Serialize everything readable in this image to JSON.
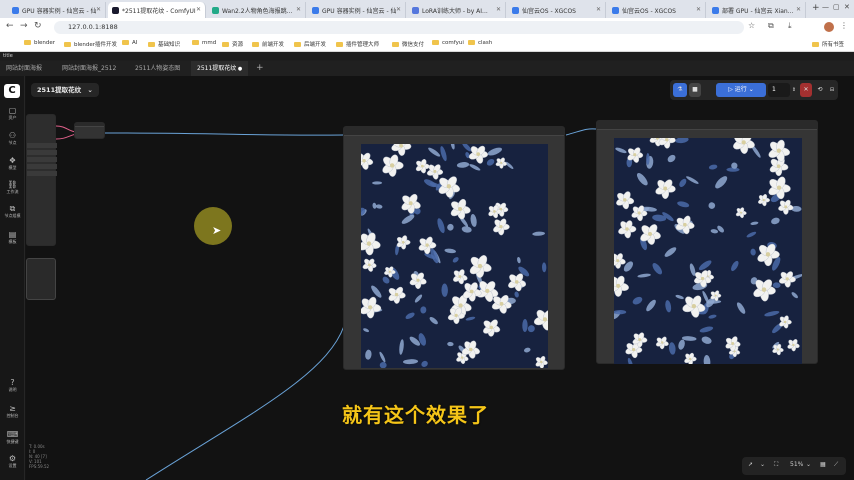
{
  "browser": {
    "tabs": [
      {
        "label": "GPU 容器实例 - 仙宫云 - 仙",
        "color": "#3b7bea",
        "active": false
      },
      {
        "label": "*2511提取花纹 - ComfyUI",
        "color": "#1a1a2e",
        "active": true
      },
      {
        "label": "Wan2.2人物角色海报跳...",
        "color": "#22aa88",
        "active": false
      },
      {
        "label": "GPU 容器实例 - 仙宫云 - 仙",
        "color": "#3b7bea",
        "active": false
      },
      {
        "label": "LoRA训练大师 - by AI...",
        "color": "#5577dd",
        "active": false
      },
      {
        "label": "仙宫云OS - XGCOS",
        "color": "#3b7bea",
        "active": false
      },
      {
        "label": "仙宫云OS - XGCOS",
        "color": "#3b7bea",
        "active": false
      },
      {
        "label": "部署 GPU - 仙宫云 Xian...",
        "color": "#3b7bea",
        "active": false
      }
    ],
    "url": "127.0.0.1:8188",
    "bookmarks": [
      "blender",
      "blender插件开发",
      "AI",
      "基础知识",
      "mmd",
      "资源",
      "前端开发",
      "后端开发",
      "插件管理大师",
      "微信支付",
      "comfyui",
      "clash"
    ],
    "all_bookmarks_label": "所有书签"
  },
  "app": {
    "title": "title",
    "workflow_tabs": [
      {
        "label": "网站封面海报",
        "active": false
      },
      {
        "label": "网站封面海报_2512",
        "active": false
      },
      {
        "label": "2511人物姿态图",
        "active": false
      },
      {
        "label": "2511提取花纹",
        "active": true,
        "unsaved": true
      }
    ],
    "workflow_name": "2511提取花纹",
    "sidebar": [
      {
        "icon": "cube-icon",
        "glyph": "▢",
        "label": "资产"
      },
      {
        "icon": "nodes-icon",
        "glyph": "⚇",
        "label": "节点"
      },
      {
        "icon": "model-icon",
        "glyph": "❖",
        "label": "模型"
      },
      {
        "icon": "workflow-icon",
        "glyph": "⛓",
        "label": "工作流"
      },
      {
        "icon": "node-library-icon",
        "glyph": "⧉",
        "label": "节点组模"
      },
      {
        "icon": "template-icon",
        "glyph": "▤",
        "label": "模板"
      }
    ],
    "sidebar_bottom": [
      {
        "icon": "help-icon",
        "glyph": "?",
        "label": "说明"
      },
      {
        "icon": "console-icon",
        "glyph": "≥",
        "label": "控制台"
      },
      {
        "icon": "keyboard-icon",
        "glyph": "⌨",
        "label": "快捷键"
      },
      {
        "icon": "settings-icon",
        "glyph": "⚙",
        "label": "设置"
      }
    ],
    "toolbar": {
      "run_label": "运行",
      "queue_count": "1"
    },
    "stats": [
      "T: 0.00s",
      "I: 0",
      "N: 40 [7]",
      "V: 101",
      "FPS:59.52"
    ],
    "zoom": "51%",
    "subtitle": "就有这个效果了",
    "colors": {
      "accent_blue": "#3b6fd8",
      "stop_red": "#a33030",
      "subtitle_yellow": "#f5c518",
      "pattern_navy": "#17223f"
    }
  }
}
